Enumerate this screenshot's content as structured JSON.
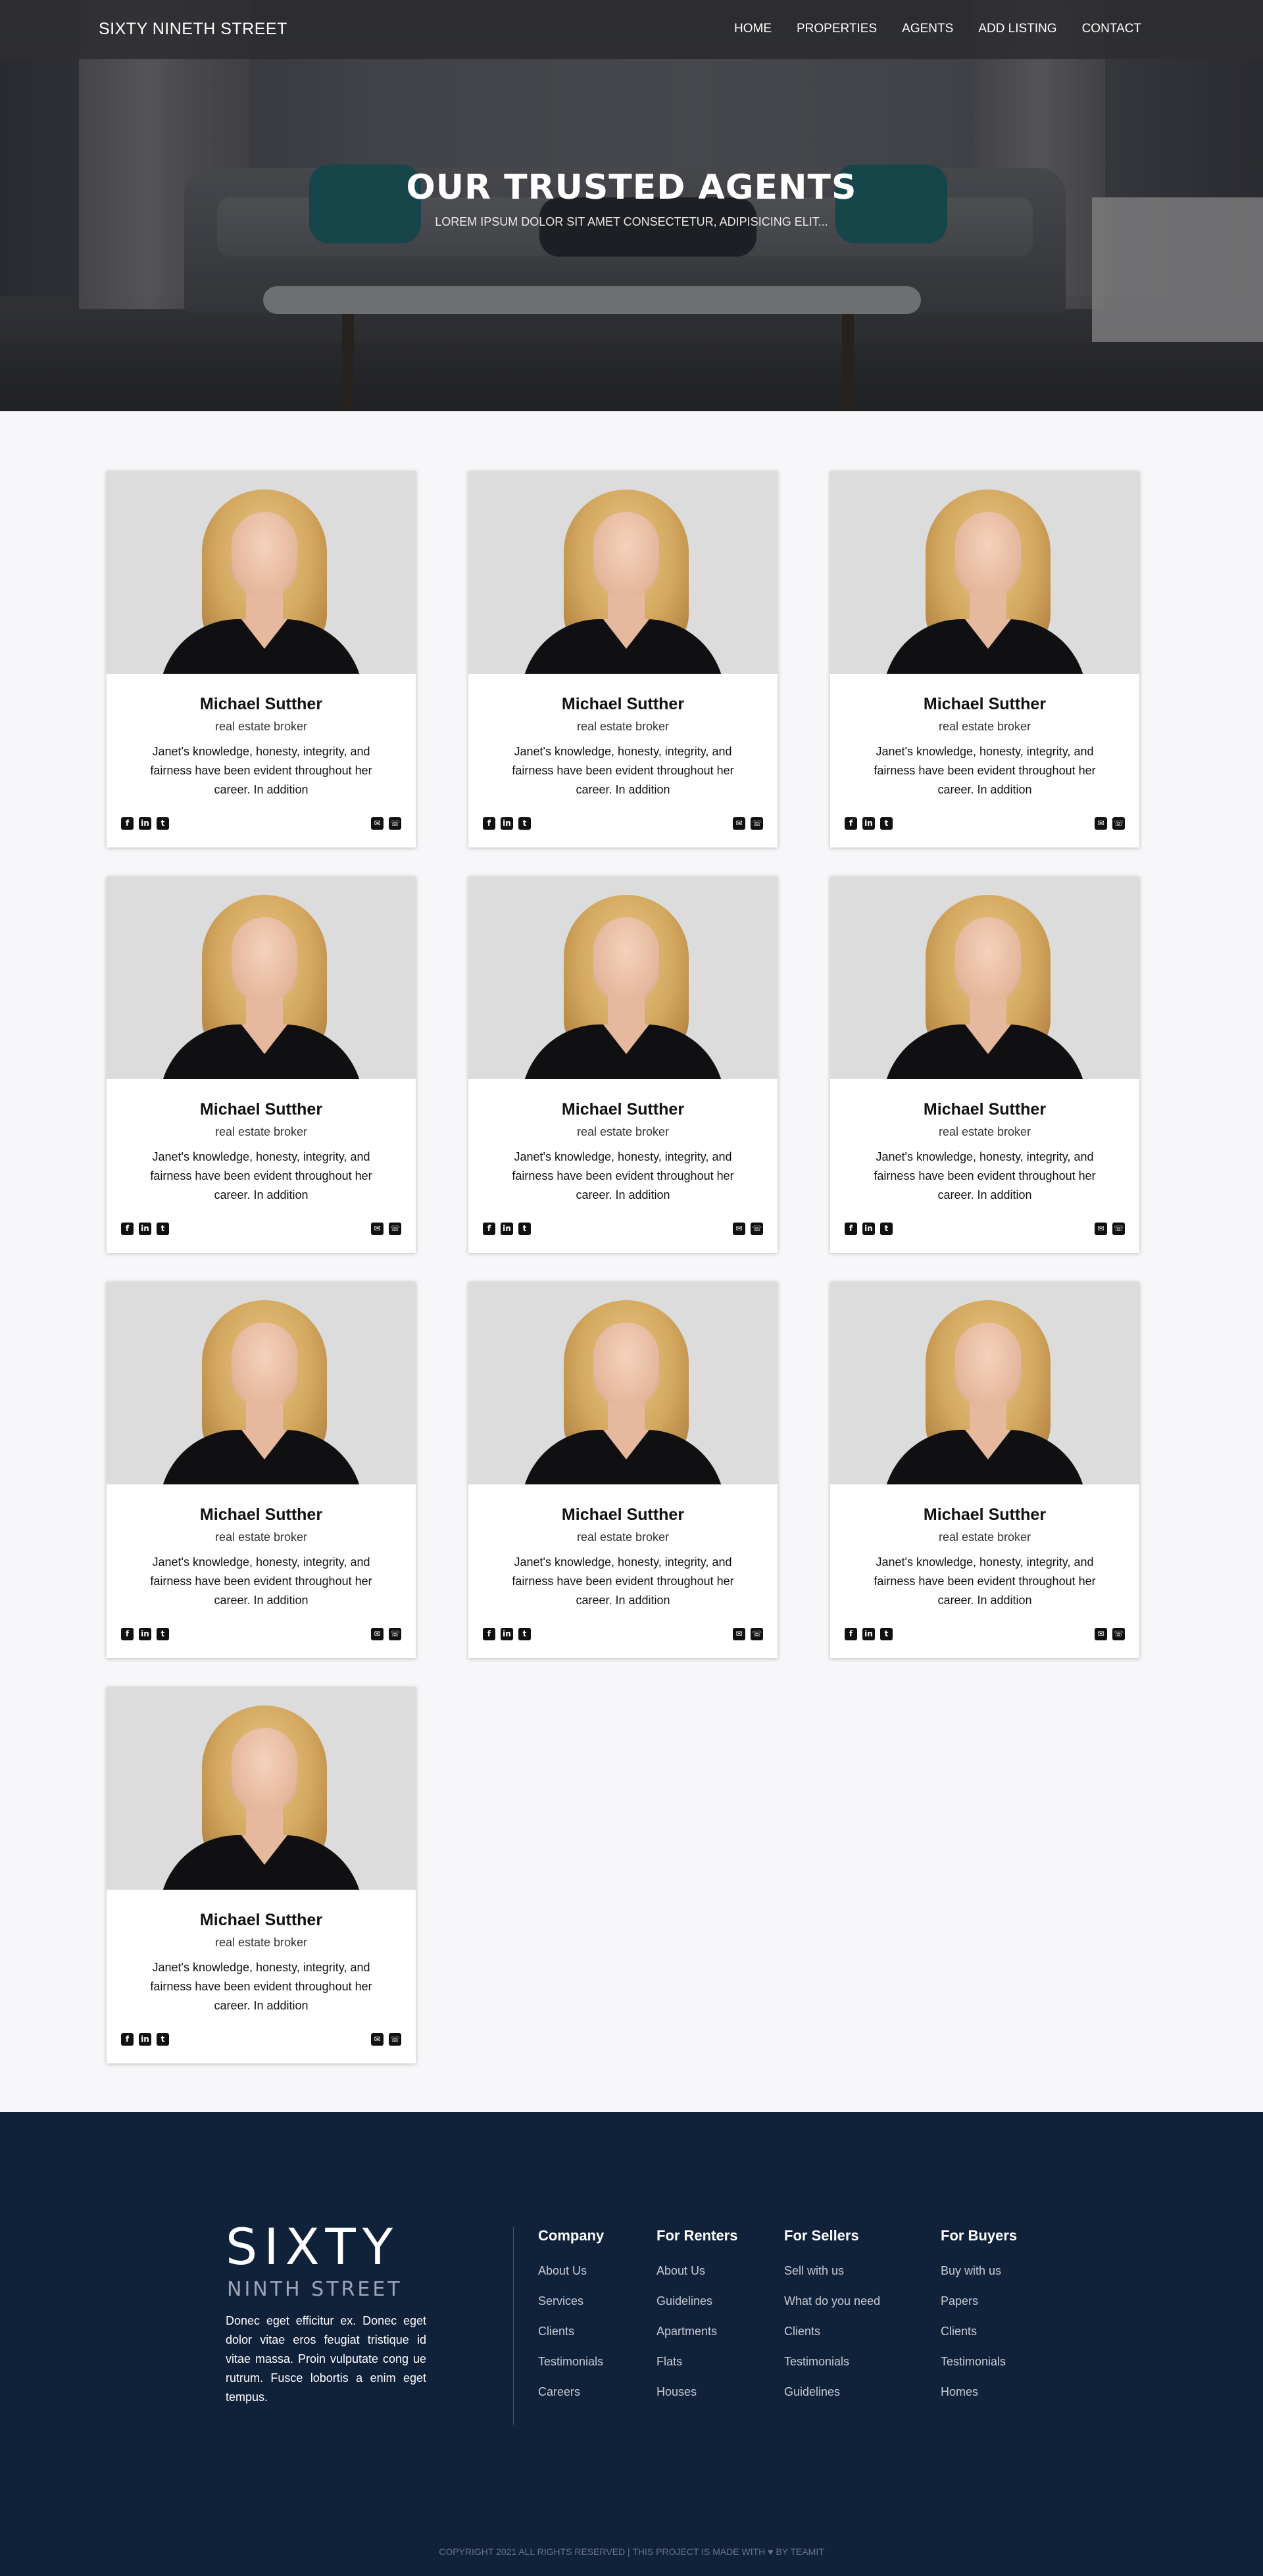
{
  "brand": "SIXTY NINETH STREET",
  "nav": [
    "HOME",
    "PROPERTIES",
    "AGENTS",
    "ADD LISTING",
    "CONTACT"
  ],
  "hero": {
    "title": "OUR TRUSTED AGENTS",
    "subtitle": "LOREM IPSUM DOLOR SIT AMET CONSECTETUR, ADIPISICING ELIT..."
  },
  "agents": [
    {
      "name": "Michael Sutther",
      "role": "real estate broker",
      "description": "Janet's knowledge, honesty, integrity, and fairness have been evident throughout her career. In addition"
    },
    {
      "name": "Michael Sutther",
      "role": "real estate broker",
      "description": "Janet's knowledge, honesty, integrity, and fairness have been evident throughout her career. In addition"
    },
    {
      "name": "Michael Sutther",
      "role": "real estate broker",
      "description": "Janet's knowledge, honesty, integrity, and fairness have been evident throughout her career. In addition"
    },
    {
      "name": "Michael Sutther",
      "role": "real estate broker",
      "description": "Janet's knowledge, honesty, integrity, and fairness have been evident throughout her career. In addition"
    },
    {
      "name": "Michael Sutther",
      "role": "real estate broker",
      "description": "Janet's knowledge, honesty, integrity, and fairness have been evident throughout her career. In addition"
    },
    {
      "name": "Michael Sutther",
      "role": "real estate broker",
      "description": "Janet's knowledge, honesty, integrity, and fairness have been evident throughout her career. In addition"
    },
    {
      "name": "Michael Sutther",
      "role": "real estate broker",
      "description": "Janet's knowledge, honesty, integrity, and fairness have been evident throughout her career. In addition"
    },
    {
      "name": "Michael Sutther",
      "role": "real estate broker",
      "description": "Janet's knowledge, honesty, integrity, and fairness have been evident throughout her career. In addition"
    },
    {
      "name": "Michael Sutther",
      "role": "real estate broker",
      "description": "Janet's knowledge, honesty, integrity, and fairness have been evident throughout her career. In addition"
    },
    {
      "name": "Michael Sutther",
      "role": "real estate broker",
      "description": "Janet's knowledge, honesty, integrity, and fairness have been evident throughout her career. In addition"
    }
  ],
  "card_icons": {
    "social": [
      "facebook-icon",
      "linkedin-icon",
      "twitter-icon"
    ],
    "contact": [
      "envelope-icon",
      "phone-icon"
    ]
  },
  "footer": {
    "logo": "SIXTY",
    "sublogo": "NINTH STREET",
    "text": "Donec eget efficitur ex. Donec eget dolor vitae eros feugiat tristique id vitae massa. Proin vulputate cong ue rutrum. Fusce lobortis a enim eget tempus.",
    "columns": [
      {
        "title": "Company",
        "links": [
          "About Us",
          "Services",
          "Clients",
          "Testimonials",
          "Careers"
        ]
      },
      {
        "title": "For Renters",
        "links": [
          "About Us",
          "Guidelines",
          "Apartments",
          "Flats",
          "Houses"
        ]
      },
      {
        "title": "For Sellers",
        "links": [
          "Sell with us",
          "What do you need",
          "Clients",
          "Testimonials",
          "Guidelines"
        ]
      },
      {
        "title": "For Buyers",
        "links": [
          "Buy with us",
          "Papers",
          "Clients",
          "Testimonials",
          "Homes"
        ]
      }
    ],
    "copyright": "COPYRIGHT 2021 ALL RIGHTS RESERVED | THIS PROJECT IS MADE WITH ♥ BY TEAMIT"
  },
  "colors": {
    "footer_bg": "#10213a",
    "page_bg": "#f7f7f9",
    "navbar_bg": "#2d2d30"
  }
}
